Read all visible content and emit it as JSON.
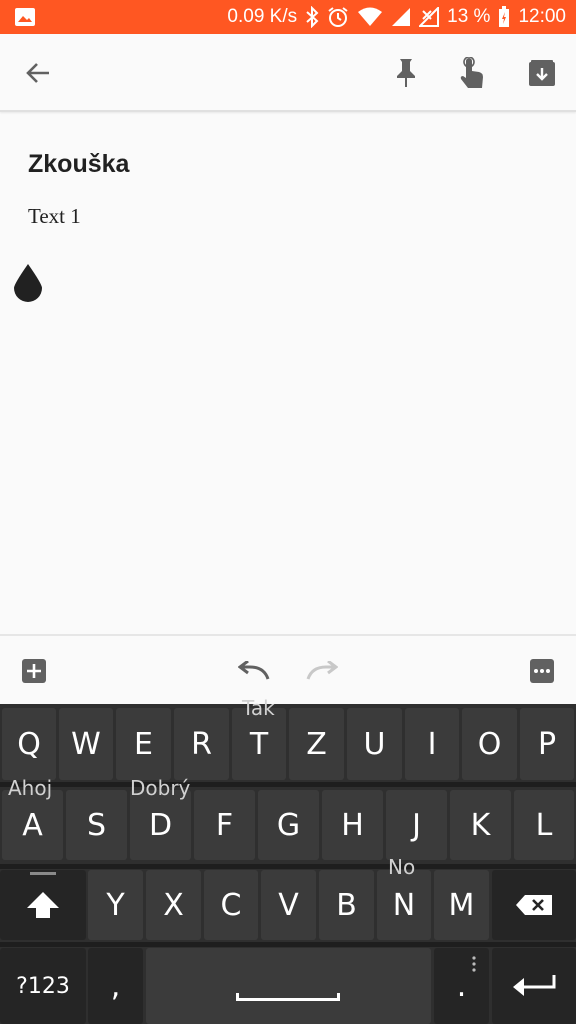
{
  "status_bar": {
    "network_speed": "0.09 K/s",
    "battery": "13 %",
    "time": "12:00"
  },
  "app_bar": {
    "back_icon": "arrow-back-icon",
    "pin_icon": "pin-icon",
    "reminder_icon": "reminder-hand-icon",
    "archive_icon": "archive-icon"
  },
  "note": {
    "title": "Zkouška",
    "body": "Text 1"
  },
  "bottom_toolbar": {
    "add_icon": "add-box-icon",
    "undo_icon": "undo-icon",
    "redo_icon": "redo-icon",
    "more_icon": "more-horiz-icon"
  },
  "keyboard": {
    "suggestions": {
      "tak": "Tak",
      "ahoj": "Ahoj",
      "dobry": "Dobrý",
      "no": "No"
    },
    "row1": [
      "Q",
      "W",
      "E",
      "R",
      "T",
      "Z",
      "U",
      "I",
      "O",
      "P"
    ],
    "row2": [
      "A",
      "S",
      "D",
      "F",
      "G",
      "H",
      "J",
      "K",
      "L"
    ],
    "row3": [
      "Y",
      "X",
      "C",
      "V",
      "B",
      "N",
      "M"
    ],
    "row4": {
      "symbols": "?123",
      "comma": ",",
      "period": "."
    }
  }
}
